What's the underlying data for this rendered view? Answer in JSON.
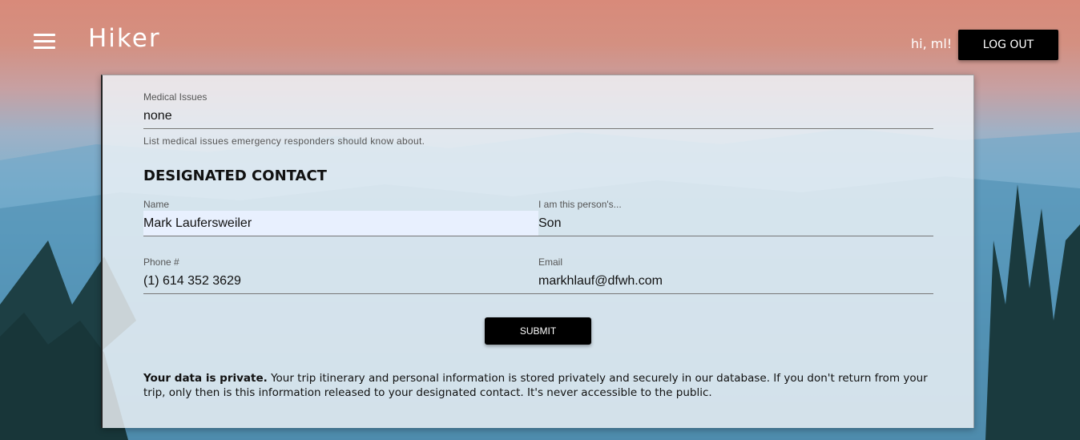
{
  "header": {
    "title": "Hiker",
    "greeting": "hi, ml!",
    "logout_label": "LOG OUT",
    "menu_icon": "menu-icon"
  },
  "medical": {
    "label": "Medical Issues",
    "value": "none",
    "helper": "List medical issues emergency responders should know about."
  },
  "contact": {
    "heading": "DESIGNATED CONTACT",
    "name_label": "Name",
    "name_value": "Mark Laufersweiler",
    "relation_label": "I am this person's...",
    "relation_value": "Son",
    "phone_label": "Phone #",
    "phone_value": "(1) 614 352 3629",
    "email_label": "Email",
    "email_value": "markhlauf@dfwh.com"
  },
  "submit_label": "SUBMIT",
  "privacy": {
    "bold": "Your data is private.",
    "text": " Your trip itinerary and personal information is stored privately and securely in our database. If you don't return from your trip, only then is this information released to your designated contact. It's never accessible to the public."
  },
  "colors": {
    "button_bg": "#000000",
    "button_text": "#ffffff",
    "autofill_bg": "#e8f0fe"
  }
}
